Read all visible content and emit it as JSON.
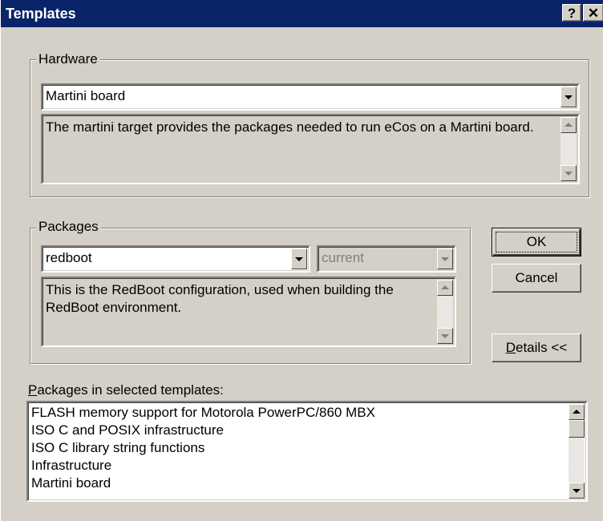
{
  "window": {
    "title": "Templates",
    "help_label": "?",
    "close_label": "✕"
  },
  "hardware": {
    "legend": "Hardware",
    "selected": "Martini board",
    "description": "The martini target provides the packages needed to run eCos on a Martini board."
  },
  "packages": {
    "legend": "Packages",
    "selected": "redboot",
    "version": "current",
    "description": "This is the RedBoot configuration, used when building the RedBoot environment."
  },
  "buttons": {
    "ok_label": "OK",
    "cancel_label": "Cancel",
    "details_mnemonic": "D",
    "details_rest": "etails <<"
  },
  "selected_list": {
    "label_mnemonic": "P",
    "label_rest": "ackages in selected templates:",
    "items": [
      "FLASH memory support for Motorola PowerPC/860 MBX",
      "ISO C and POSIX infrastructure",
      "ISO C library string functions",
      "Infrastructure",
      "Martini board"
    ]
  },
  "icons": {
    "help": "help-icon",
    "close": "close-icon",
    "dropdown": "chevron-down-icon",
    "scroll_up": "scroll-up-icon",
    "scroll_down": "scroll-down-icon"
  }
}
